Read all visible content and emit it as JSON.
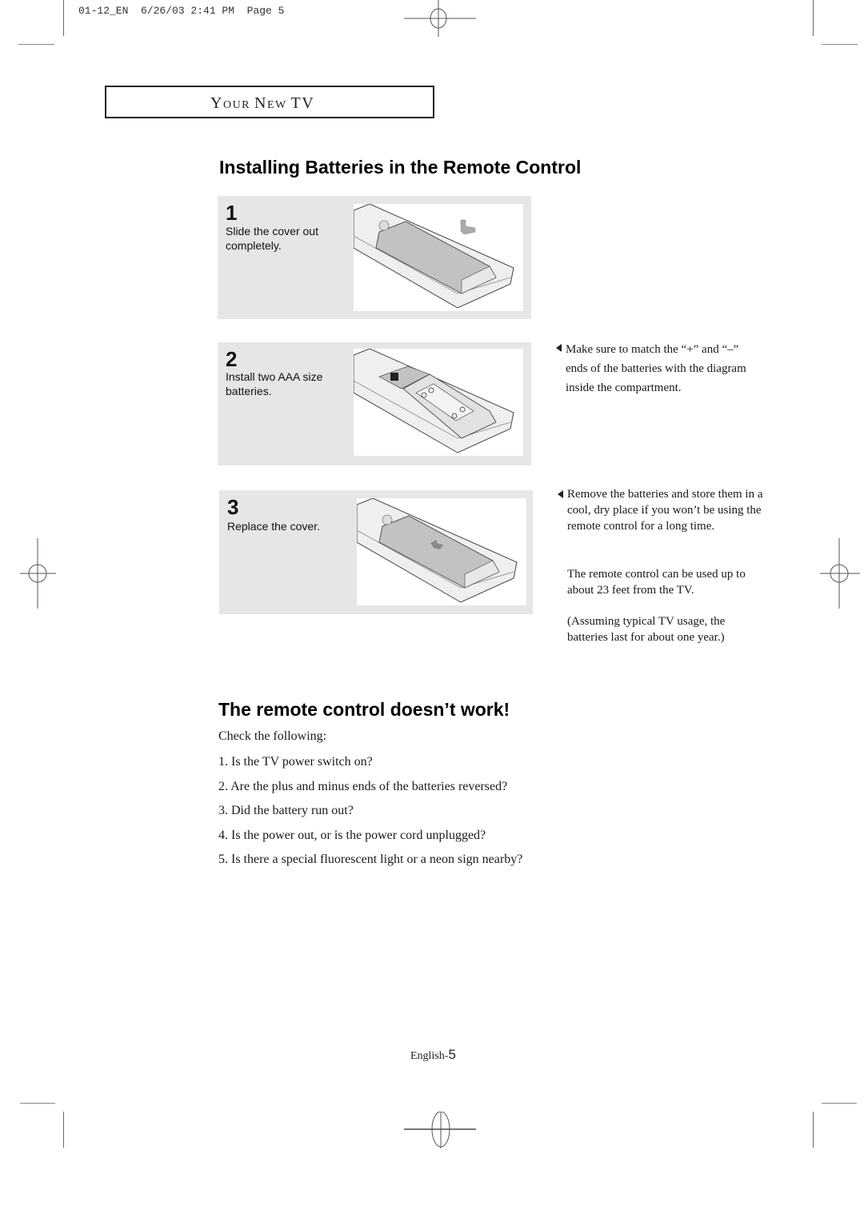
{
  "slug": "01-12_EN  6/26/03 2:41 PM  Page 5",
  "section_header": {
    "parts": [
      {
        "big": "Y",
        "small": "OUR "
      },
      {
        "big": "N",
        "small": "EW "
      },
      {
        "big": "TV",
        "small": ""
      }
    ]
  },
  "installing": {
    "title": "Installing Batteries in the Remote Control",
    "steps": [
      {
        "number": "1",
        "text": "Slide the cover out completely.",
        "illustration": "remote-cover-slide-out"
      },
      {
        "number": "2",
        "text": "Install two AAA size batteries.",
        "illustration": "remote-batteries-installed"
      },
      {
        "number": "3",
        "text": "Replace the cover.",
        "illustration": "remote-cover-replace"
      }
    ],
    "notes": {
      "polarity": "Make sure to match the “+” and “–” ends of the batteries with the diagram inside the compartment.",
      "storage": "Remove the batteries and store them in a cool, dry place if you won’t be using the remote control for a long time.",
      "range": "The remote control can be used up to about 23 feet from the TV.",
      "battery_life": "(Assuming typical TV usage, the batteries last for about one year.)"
    }
  },
  "troubleshoot": {
    "title": "The remote control doesn’t work!",
    "intro": "Check the following:",
    "items": [
      "1. Is the TV power switch on?",
      "2. Are the plus and minus ends of the batteries reversed?",
      "3. Did the battery run out?",
      "4. Is the power out, or is the power cord unplugged?",
      "5. Is there a special fluorescent light or a neon sign nearby?"
    ]
  },
  "footer": {
    "label": "English-",
    "page_number": "5"
  }
}
